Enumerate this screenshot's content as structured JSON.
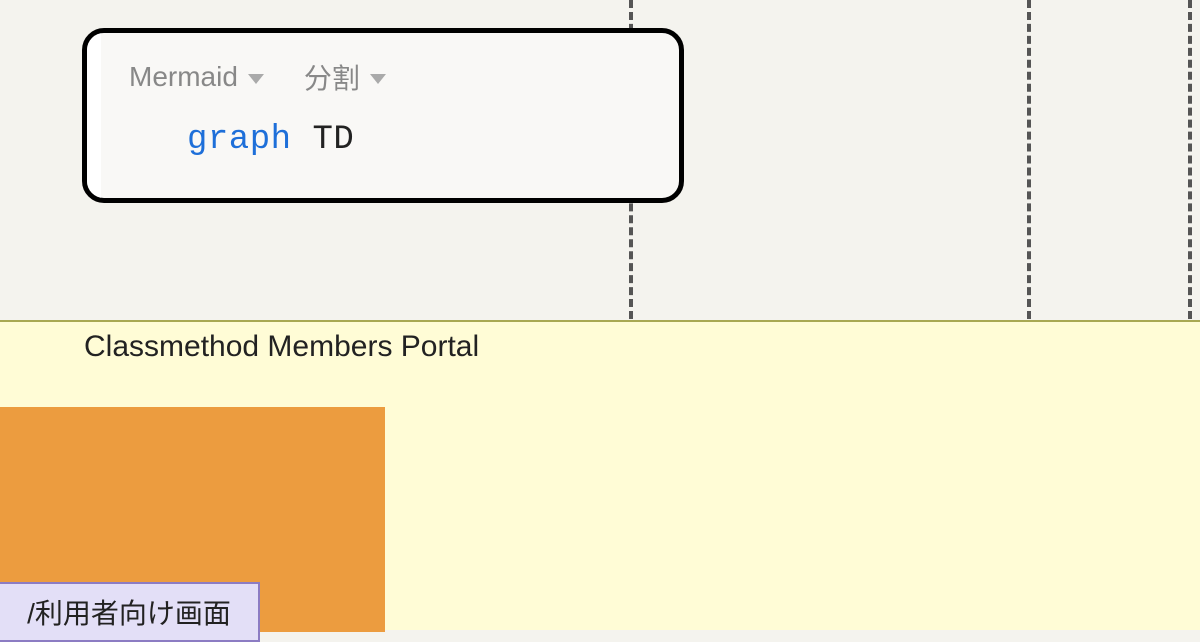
{
  "editor": {
    "language_dropdown": {
      "label": "Mermaid"
    },
    "view_dropdown": {
      "label": "分割"
    },
    "code": {
      "keyword": "graph",
      "direction": "TD"
    }
  },
  "diagram": {
    "section_title": "Classmethod Members Portal",
    "inner_box_label": "/利用者向け画面"
  }
}
